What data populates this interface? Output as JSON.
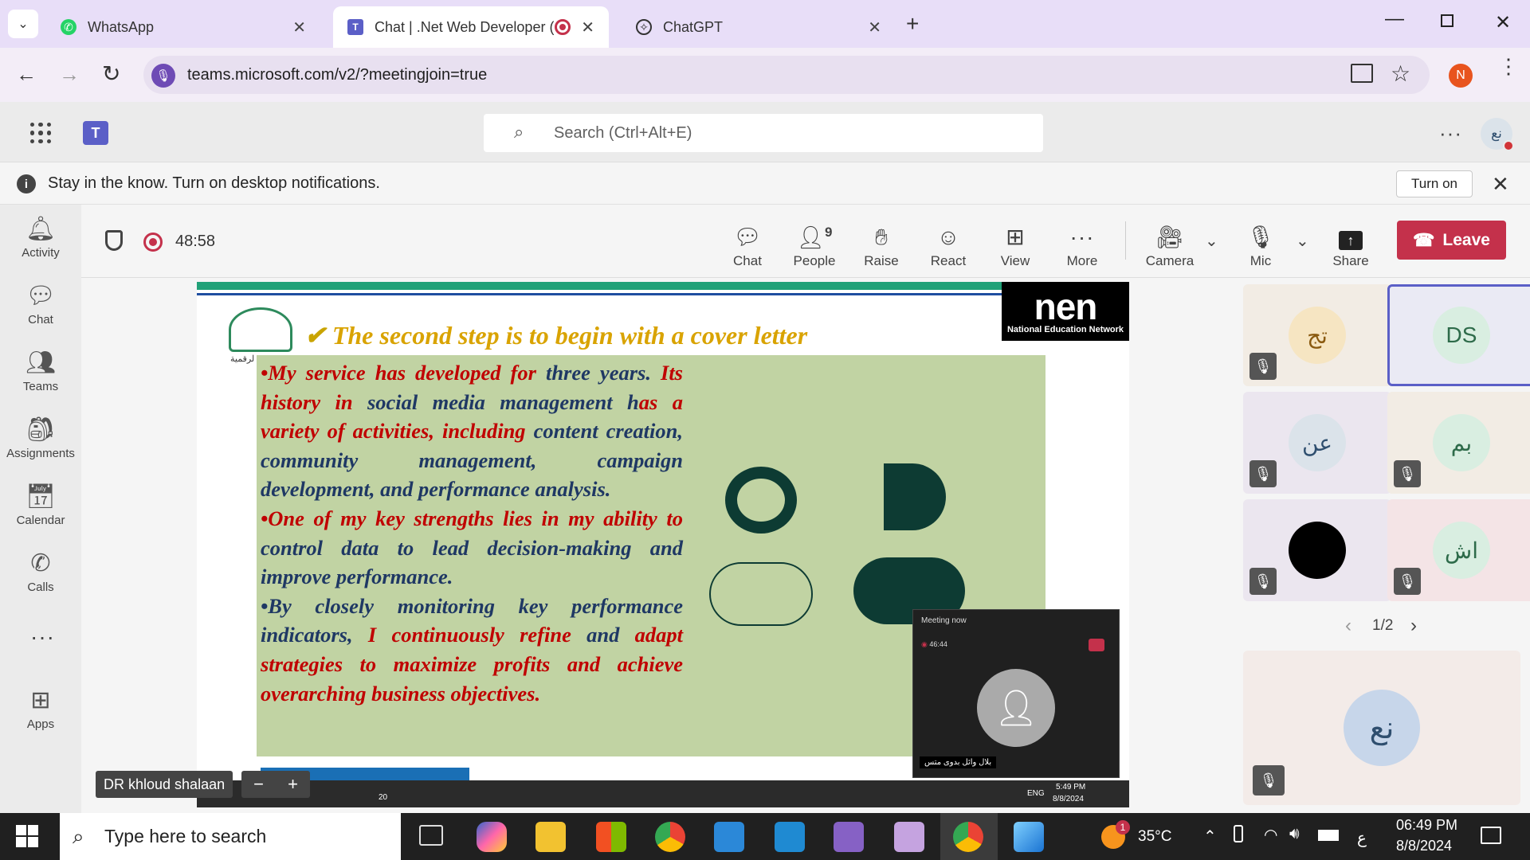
{
  "browser": {
    "tabs": [
      {
        "label": "WhatsApp"
      },
      {
        "label": "Chat | .Net Web Developer ("
      },
      {
        "label": "ChatGPT"
      }
    ],
    "url": "teams.microsoft.com/v2/?meetingjoin=true",
    "profile_initial": "N"
  },
  "teams": {
    "search_placeholder": "Search (Ctrl+Alt+E)",
    "user_avatar": "نع",
    "notification": "Stay in the know. Turn on desktop notifications.",
    "turn_on": "Turn on"
  },
  "rail": [
    {
      "label": "Activity",
      "icon": "bell-icon"
    },
    {
      "label": "Chat",
      "icon": "chat-icon"
    },
    {
      "label": "Teams",
      "icon": "teams-icon"
    },
    {
      "label": "Assignments",
      "icon": "backpack-icon"
    },
    {
      "label": "Calendar",
      "icon": "calendar-icon"
    },
    {
      "label": "Calls",
      "icon": "phone-icon"
    },
    {
      "label": "Apps",
      "icon": "plus-square-icon"
    }
  ],
  "meeting": {
    "timer": "48:58",
    "controls": {
      "chat": "Chat",
      "people": "People",
      "people_count": "9",
      "raise": "Raise",
      "react": "React",
      "view": "View",
      "more": "More",
      "camera": "Camera",
      "mic": "Mic",
      "share": "Share",
      "leave": "Leave"
    },
    "presenter_name": "DR khloud shalaan",
    "page": "1/2"
  },
  "slide": {
    "title": "The second step is to begin with a cover letter",
    "logo_text": "nen",
    "logo_sub": "National Education Network",
    "small_logo_text": "لرقمية"
  },
  "participants": [
    {
      "initials": "تج",
      "bg": "#f6e5c2",
      "fg": "#8a5a10",
      "muted": true
    },
    {
      "initials": "DS",
      "bg": "#d9eee1",
      "fg": "#2e6b4a",
      "muted": false
    },
    {
      "initials": "عن",
      "bg": "#dbe3ea",
      "fg": "#2f4f6f",
      "muted": true
    },
    {
      "initials": "بم",
      "bg": "#d9eee1",
      "fg": "#2e6b4a",
      "muted": true
    },
    {
      "initials": "",
      "bg": "#000000",
      "fg": "#ffffff",
      "muted": true
    },
    {
      "initials": "اش",
      "bg": "#d9eee1",
      "fg": "#2e6b4a",
      "muted": true
    }
  ],
  "self_tile": {
    "initials": "نع"
  },
  "mini_meeting": {
    "title": "Meeting now",
    "timer": "46:44",
    "name": "بلال وائل بدوى متس"
  },
  "inner_taskbar": {
    "time": "5:49 PM",
    "date": "8/8/2024",
    "lang": "ENG",
    "badge": "20"
  },
  "windows": {
    "search_placeholder": "Type here to search",
    "weather": "35°C",
    "weather_badge": "1",
    "time": "06:49 PM",
    "date": "8/8/2024",
    "lang": "ع"
  }
}
